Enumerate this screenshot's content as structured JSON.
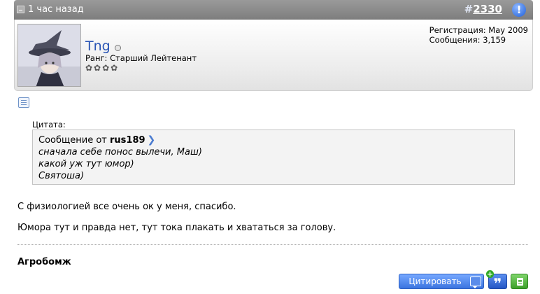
{
  "header": {
    "date": "1 час назад",
    "post_hash": "#",
    "post_number": "2330",
    "report_label": "!"
  },
  "user": {
    "name": "Tng",
    "rank": "Ранг: Старший Лейтенант",
    "stars": "✿✿✿✿",
    "registration": "Регистрация: May 2009",
    "messages": "Сообщения: 3,159"
  },
  "quote": {
    "label": "Цитата:",
    "from_prefix": "Сообщение от",
    "from_user": "rus189",
    "lines": [
      "сначала себе понос вылечи, Маш)",
      "какой уж тут юмор)",
      "Святоша)"
    ]
  },
  "message": {
    "lines": [
      "С физиологией все очень ок у меня, спасибо.",
      "Юмора тут и правда нет, тут тока плакать и хвататься за голову."
    ]
  },
  "signature": "Агробомж",
  "buttons": {
    "quote": "Цитировать",
    "multiquote_glyph": "❞",
    "plus": "+"
  },
  "icons": {
    "date": "page-icon",
    "report": "exclamation-icon",
    "online": "online-status-icon",
    "post": "post-icon",
    "view_post": "chevron-right-icon",
    "quote_button": "comment-icon",
    "multiquote": "quote-marks-icon",
    "quick_reply": "document-icon"
  },
  "colors": {
    "header_bg": "#8c8c8c",
    "username": "#2a55b5",
    "button_blue": "#3a74e0",
    "button_green": "#3c9f2a"
  }
}
